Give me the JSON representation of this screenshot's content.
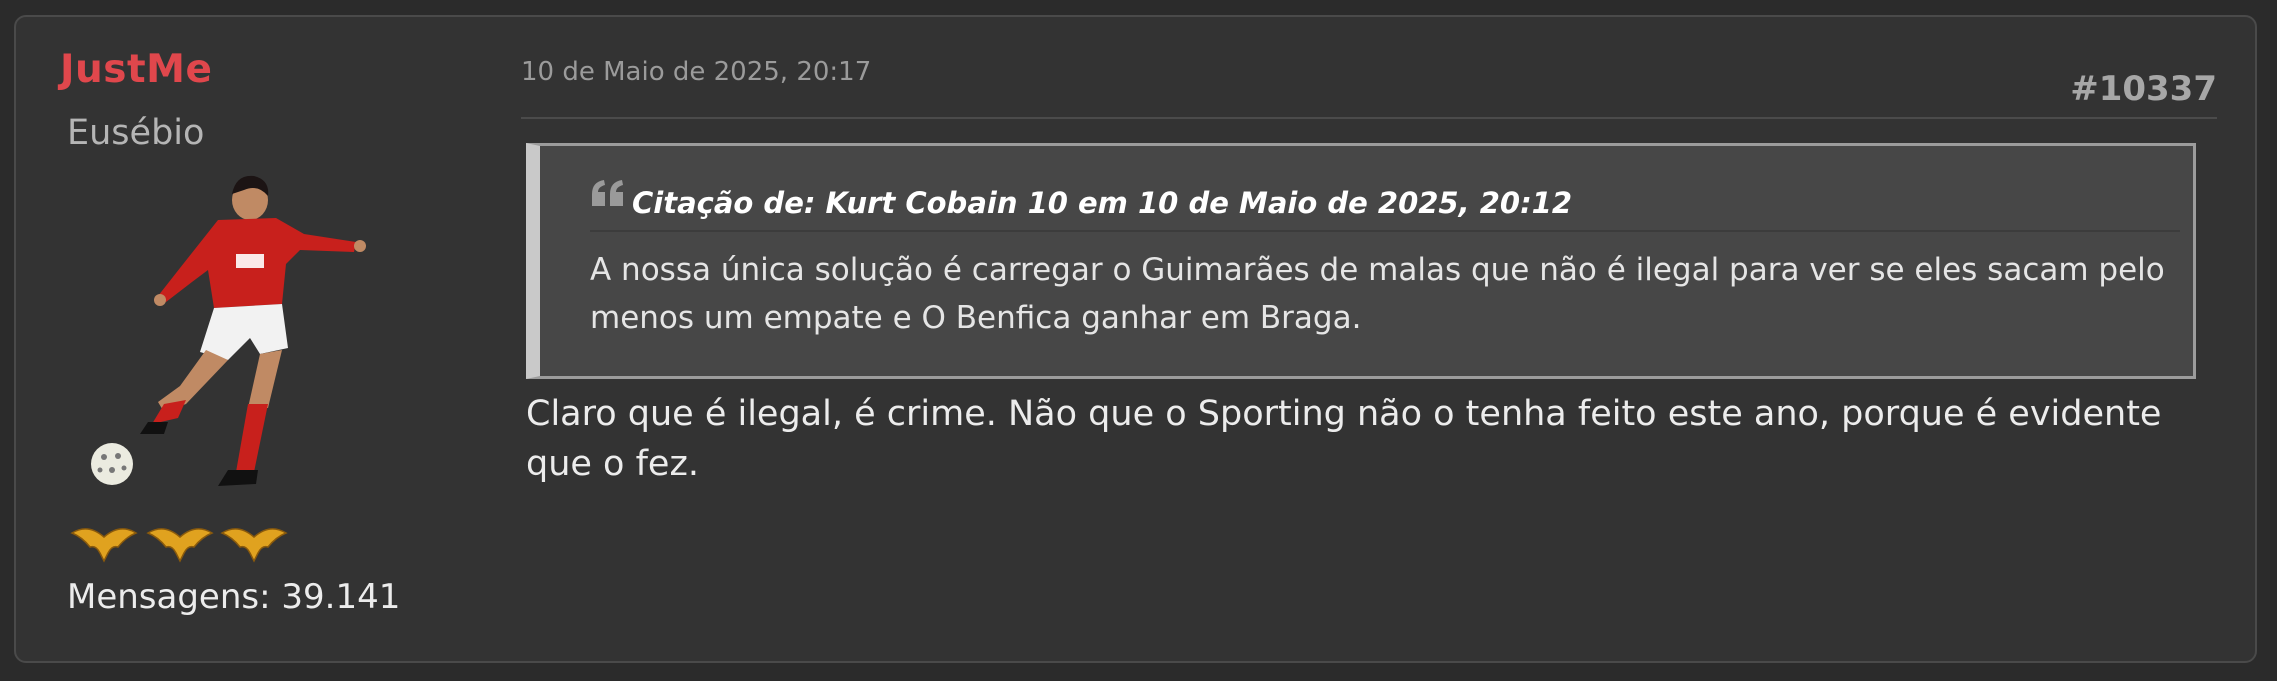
{
  "author": {
    "name": "JustMe",
    "rank": "Eusébio",
    "avatar_icon": "benfica-player-kicking-ball-icon",
    "badge_icon": "gold-eagle-icon",
    "badge_count": 3,
    "post_count_label": "Mensagens: 39.141"
  },
  "post": {
    "date": "10 de Maio de 2025, 20:17",
    "number": "#10337",
    "quote": {
      "icon": "quote-marks-icon",
      "title": "Citação de: Kurt Cobain 10 em 10 de Maio de 2025, 20:12",
      "text": "A nossa única solução é carregar o Guimarães de malas que não é ilegal para ver se eles sacam pelo menos um empate e O Benfica ganhar em Braga."
    },
    "body": "Claro que é ilegal, é crime. Não que o Sporting não o tenha feito este ano, porque é evidente que o fez."
  },
  "colors": {
    "page_background": "#2b2b2b",
    "post_background": "#333333",
    "author_name": "#e0474c",
    "quote_background": "#474747",
    "quote_border": "#9c9c9c",
    "badge_gold": "#e0a21f"
  }
}
